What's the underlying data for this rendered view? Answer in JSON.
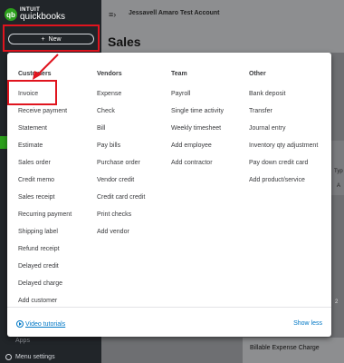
{
  "app": {
    "logo_intuit": "INTUIT",
    "logo_name": "quickbooks",
    "logo_mark": "qb",
    "new_button": "New",
    "account_name": "Jessavell Amaro Test Account",
    "page_title": "Sales",
    "apps_label": "Apps",
    "menu_settings": "Menu settings"
  },
  "menu": {
    "columns": [
      {
        "title": "Customers",
        "items": [
          "Invoice",
          "Receive payment",
          "Statement",
          "Estimate",
          "Sales order",
          "Credit memo",
          "Sales receipt",
          "Recurring payment",
          "Shipping label",
          "Refund receipt",
          "Delayed credit",
          "Delayed charge",
          "Add customer"
        ]
      },
      {
        "title": "Vendors",
        "items": [
          "Expense",
          "Check",
          "Bill",
          "Pay bills",
          "Purchase order",
          "Vendor credit",
          "Credit card credit",
          "Print checks",
          "Add vendor"
        ]
      },
      {
        "title": "Team",
        "items": [
          "Payroll",
          "Single time activity",
          "Weekly timesheet",
          "Add employee",
          "Add contractor"
        ]
      },
      {
        "title": "Other",
        "items": [
          "Bank deposit",
          "Transfer",
          "Journal entry",
          "Inventory qty adjustment",
          "Pay down credit card",
          "Add product/service"
        ]
      }
    ],
    "video_tutorials": "Video tutorials",
    "show_less": "Show less"
  },
  "background": {
    "typ_fragment": "Typ",
    "a_fragment": "A",
    "two_fragment": "2",
    "billable": "Billable Expense Charge"
  },
  "colors": {
    "highlight": "#e0141e",
    "link": "#0077c5",
    "brand": "#2ca01c"
  }
}
